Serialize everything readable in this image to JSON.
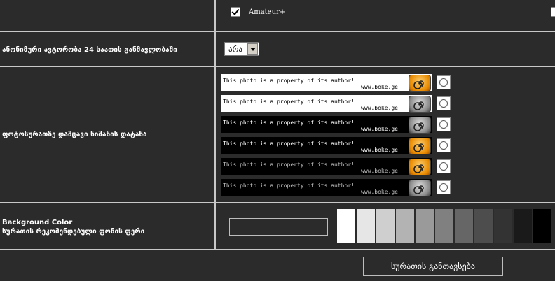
{
  "row1": {
    "checkbox_label": "Amateur+",
    "checked": true
  },
  "row2": {
    "label": "ანონიმური ავტორობა 24 საათის განმავლობაში",
    "select_value": "არა"
  },
  "row3": {
    "label": "ფოტოსურათზე დამცავი ნიშანის დატანა",
    "watermarks": [
      {
        "line1": "This photo is a property of its author!",
        "line2": "www.boke.ge",
        "bg": "#ffffff",
        "fg": "#000000",
        "logo": "orange"
      },
      {
        "line1": "This photo is a property of its author!",
        "line2": "www.boke.ge",
        "bg": "#ffffff",
        "fg": "#000000",
        "logo": "gray"
      },
      {
        "line1": "This photo is a property of its author!",
        "line2": "www.boke.ge",
        "bg": "#000000",
        "fg": "#ffffff",
        "logo": "gray"
      },
      {
        "line1": "This photo is a property of its author!",
        "line2": "www.boke.ge",
        "bg": "#000000",
        "fg": "#ffffff",
        "logo": "orange"
      },
      {
        "line1": "This photo is a property of its author!",
        "line2": "www.boke.ge",
        "bg": "#000000",
        "fg": "#bfbfbf",
        "logo": "orange"
      },
      {
        "line1": "This photo is a property of its author!",
        "line2": "www.boke.ge",
        "bg": "#000000",
        "fg": "#bfbfbf",
        "logo": "gray"
      }
    ]
  },
  "row4": {
    "label_line1": "Background Color",
    "label_line2": "სურათის რეკომენდებული ფონის ფერი",
    "color_value": "",
    "swatches": [
      "#ffffff",
      "#e6e6e6",
      "#cfcfcf",
      "#b3b3b3",
      "#9a9a9a",
      "#808080",
      "#666666",
      "#4d4d4d",
      "#333333",
      "#1a1a1a",
      "#000000"
    ]
  },
  "submit_label": "სურათის განთავსება"
}
